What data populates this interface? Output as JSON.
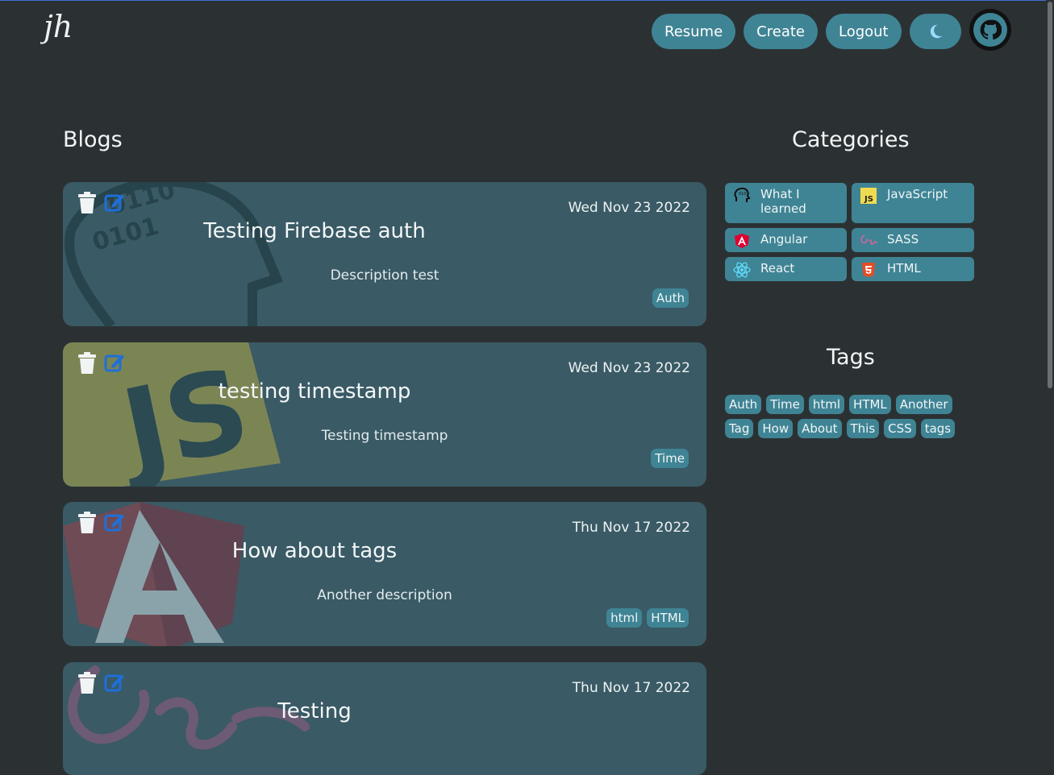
{
  "header": {
    "logo_text": "jh",
    "nav": [
      "Resume",
      "Create",
      "Logout"
    ],
    "theme_icon": "moon-icon",
    "github_icon": "github-icon"
  },
  "blogs": {
    "title": "Blogs",
    "posts": [
      {
        "title": "Testing Firebase auth",
        "date": "Wed Nov 23 2022",
        "description": "Description test",
        "tags": [
          "Auth"
        ],
        "category": "What I learned"
      },
      {
        "title": "testing timestamp",
        "date": "Wed Nov 23 2022",
        "description": "Testing timestamp",
        "tags": [
          "Time"
        ],
        "category": "JavaScript"
      },
      {
        "title": "How about tags",
        "date": "Thu Nov 17 2022",
        "description": "Another description",
        "tags": [
          "html",
          "HTML"
        ],
        "category": "Angular"
      },
      {
        "title": "Testing",
        "date": "Thu Nov 17 2022",
        "description": "",
        "tags": [],
        "category": "SASS"
      }
    ]
  },
  "categories": {
    "title": "Categories",
    "items": [
      {
        "label": "What I learned",
        "icon": "brain-head-icon"
      },
      {
        "label": "JavaScript",
        "icon": "javascript-icon"
      },
      {
        "label": "Angular",
        "icon": "angular-icon"
      },
      {
        "label": "SASS",
        "icon": "sass-icon"
      },
      {
        "label": "React",
        "icon": "react-icon"
      },
      {
        "label": "HTML",
        "icon": "html5-icon"
      }
    ]
  },
  "tags": {
    "title": "Tags",
    "items": [
      "Auth",
      "Time",
      "html",
      "HTML",
      "Another",
      "Tag",
      "How",
      "About",
      "This",
      "CSS",
      "tags"
    ]
  },
  "colors": {
    "background": "#2b3133",
    "card": "#3a5a65",
    "accent": "#3f8494",
    "edit_icon": "#1e6fd9"
  }
}
